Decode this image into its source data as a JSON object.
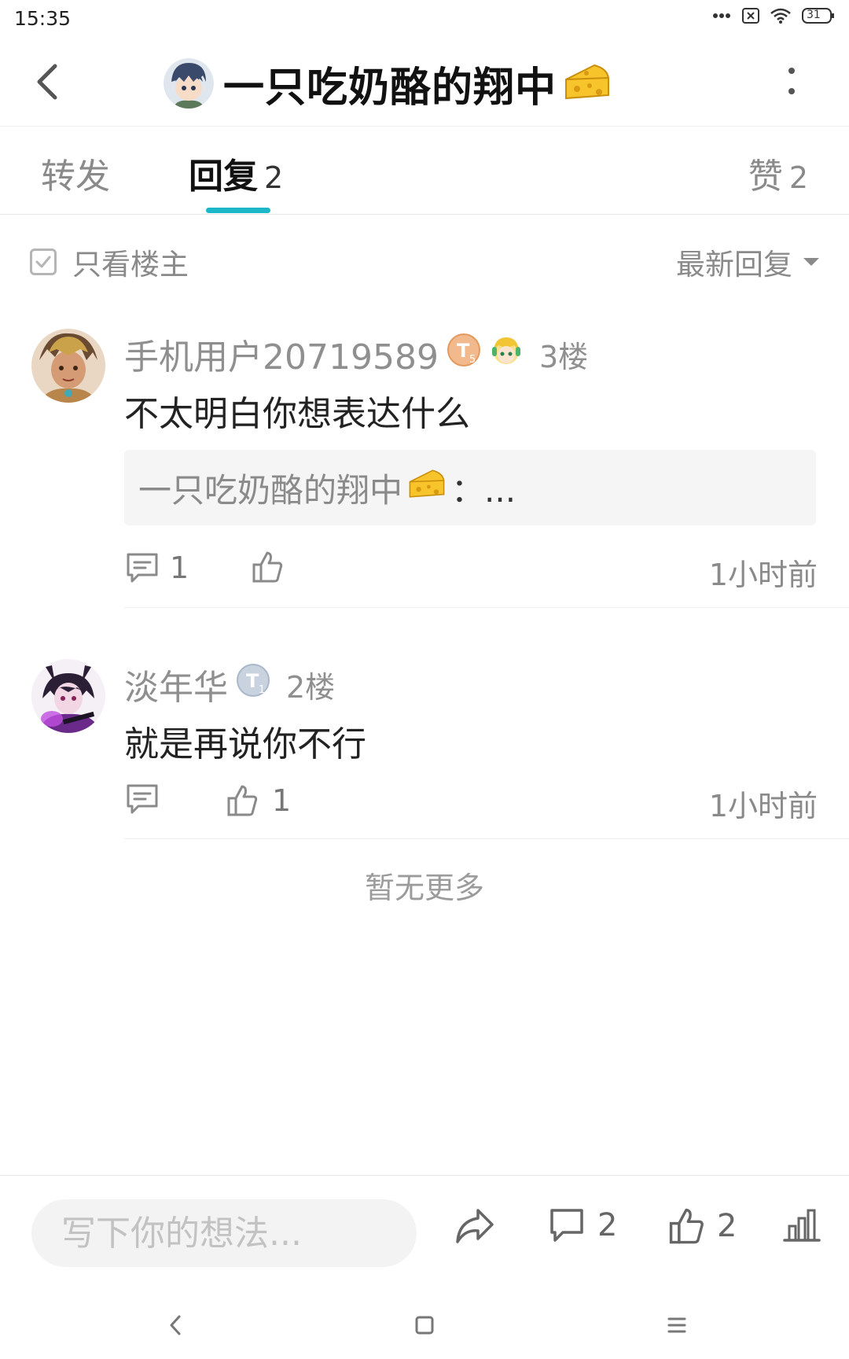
{
  "status_bar": {
    "time": "15:35",
    "battery": "31"
  },
  "header": {
    "title": "一只吃奶酪的翔中"
  },
  "tabs": [
    {
      "label": "转发",
      "count": ""
    },
    {
      "label": "回复",
      "count": "2"
    },
    {
      "label": "赞",
      "count": "2"
    }
  ],
  "filter": {
    "only_op_label": "只看楼主",
    "sort_label": "最新回复"
  },
  "replies": [
    {
      "user": "手机用户20719589",
      "badge": "T5",
      "floor": "3楼",
      "text": "不太明白你想表达什么",
      "quote_user": "一只吃奶酪的翔中",
      "quote_suffix": "：...",
      "comment_count": "1",
      "like_count": "",
      "time": "1小时前"
    },
    {
      "user": "淡年华",
      "badge": "T1",
      "floor": "2楼",
      "text": "就是再说你不行",
      "comment_count": "",
      "like_count": "1",
      "time": "1小时前"
    }
  ],
  "no_more_text": "暂无更多",
  "bottom_bar": {
    "input_placeholder": "写下你的想法...",
    "comment_count": "2",
    "like_count": "2"
  },
  "colors": {
    "accent": "#1bb6c8",
    "text_secondary": "#8a8a8a"
  }
}
